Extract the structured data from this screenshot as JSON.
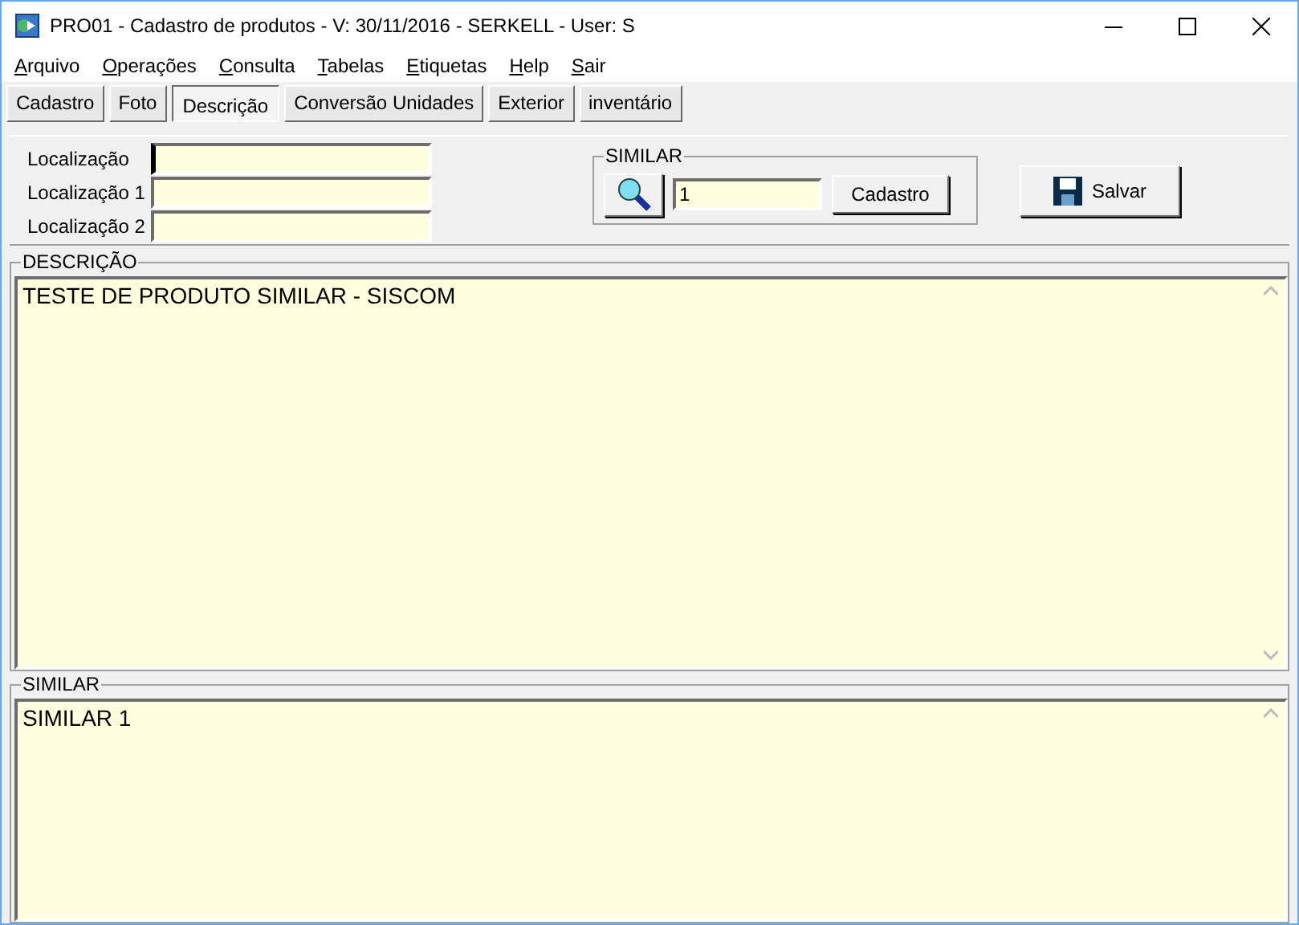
{
  "window": {
    "title": "PRO01 - Cadastro de produtos - V: 30/11/2016 - SERKELL - User: S"
  },
  "menu": [
    "Arquivo",
    "Operações",
    "Consulta",
    "Tabelas",
    "Etiquetas",
    "Help",
    "Sair"
  ],
  "tabs": [
    {
      "label": "Cadastro",
      "selected": false
    },
    {
      "label": "Foto",
      "selected": false
    },
    {
      "label": "Descrição",
      "selected": true
    },
    {
      "label": "Conversão Unidades",
      "selected": false
    },
    {
      "label": "Exterior",
      "selected": false
    },
    {
      "label": "inventário",
      "selected": false
    }
  ],
  "location_fields": [
    {
      "label": "Localização",
      "focused": true
    },
    {
      "label": "Localização 1",
      "focused": false
    },
    {
      "label": "Localização 2",
      "focused": false
    }
  ],
  "similar_group": {
    "title": "SIMILAR",
    "value": "1",
    "button": "Cadastro"
  },
  "save_button": "Salvar",
  "description": {
    "title": "DESCRIÇÃO",
    "text": "TESTE DE PRODUTO SIMILAR - SISCOM"
  },
  "similar": {
    "title": "SIMILAR",
    "text": "SIMILAR 1"
  }
}
